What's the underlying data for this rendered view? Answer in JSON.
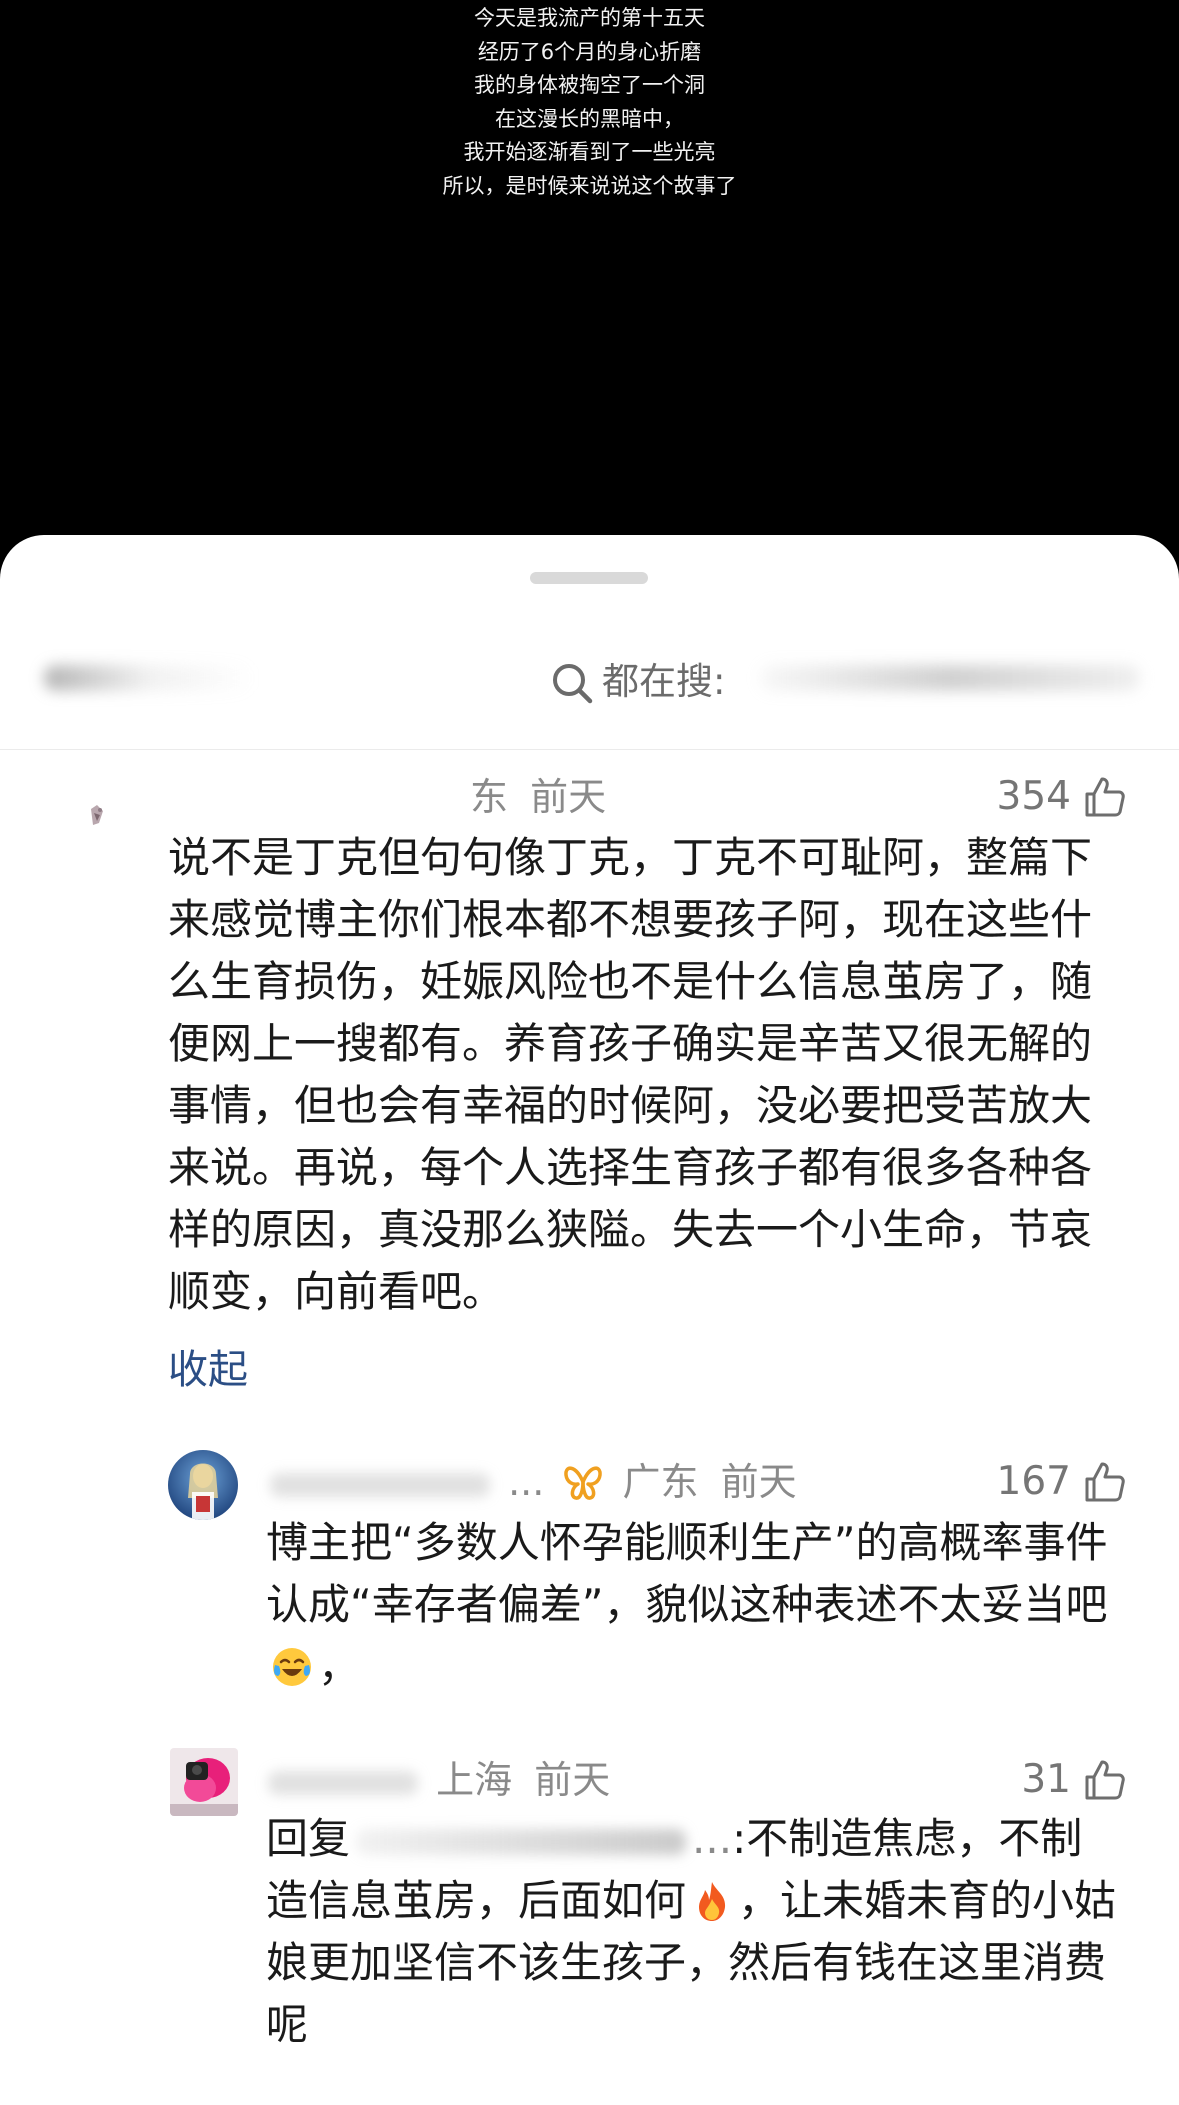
{
  "video": {
    "caption_lines": [
      "今天是我流产的第十五天",
      "经历了6个月的身心折磨",
      "我的身体被掏空了一个洞",
      "在这漫长的黑暗中，",
      "我开始逐渐看到了一些光亮",
      "所以，是时候来说说这个故事了"
    ]
  },
  "search": {
    "label": "都在搜:",
    "icon": "search-icon"
  },
  "comments": [
    {
      "location": "东",
      "time": "前天",
      "likes": "354",
      "text": "说不是丁克但句句像丁克，丁克不可耻阿，整篇下来感觉博主你们根本都不想要孩子阿，现在这些什么生育损伤，妊娠风险也不是什么信息茧房了，随便网上一搜都有。养育孩子确实是辛苦又很无解的事情，但也会有幸福的时候阿，没必要把受苦放大来说。再说，每个人选择生育孩子都有很多各种各样的原因，真没那么狭隘。失去一个小生命，节哀顺变，向前看吧。",
      "collapse_label": "收起"
    },
    {
      "ellipsis": "...",
      "location": "广东",
      "time": "前天",
      "likes": "167",
      "text_before_emoji": "博主把“多数人怀孕能顺利生产”的高概率事件认成“幸存者偏差”，貌似这种表述不太妥当吧",
      "text_after_emoji": "，",
      "badge_icon": "butterfly-badge-icon",
      "emoji_icon": "laugh-cry-emoji-icon"
    },
    {
      "location": "上海",
      "time": "前天",
      "likes": "31",
      "reply_prefix": "回复",
      "reply_ellipsis": "...",
      "text_part1": ":不制造焦虑，不制造信息茧房，后面如何",
      "text_part2": "，让未婚未育的小姑娘更加坚信不该生孩子，然后有钱在这里消费呢",
      "emoji_icon": "fire-emoji-icon"
    }
  ],
  "colors": {
    "accent_link": "#2b4e85",
    "meta_gray": "#8a8a8a",
    "badge_orange": "#f0a020"
  }
}
